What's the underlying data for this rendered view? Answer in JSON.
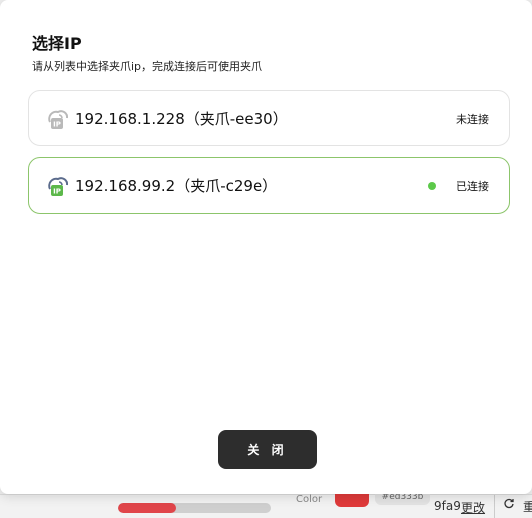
{
  "modal": {
    "title": "选择IP",
    "subtitle": "请从列表中选择夹爪ip，完成连接后可使用夹爪",
    "close_label": "关 闭"
  },
  "ip_list": [
    {
      "label": "192.168.1.228（夹爪-ee30）",
      "status": "未连接",
      "connected": false,
      "icon": "wifi-ip-icon"
    },
    {
      "label": "192.168.99.2（夹爪-c29e）",
      "status": "已连接",
      "connected": true,
      "icon": "wifi-ip-icon"
    }
  ],
  "colors": {
    "connected_border": "#8cc56b",
    "connected_dot": "#5cc94a",
    "ip_badge_disconnected": "#b9b9b9",
    "ip_badge_connected": "#5cb84a",
    "close_button": "#2d2d2d"
  },
  "background": {
    "progress_fraction": 0.38,
    "color_label": "Color",
    "hex_value": "#ed333b",
    "hash_suffix": "9fa9",
    "change_link": "更改",
    "cut_text": "重"
  }
}
